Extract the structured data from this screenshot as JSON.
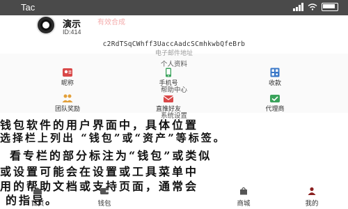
{
  "status_bar": {
    "time": "Tac"
  },
  "profile": {
    "name": "演示",
    "ghost_text": "有效合成",
    "id_label": "ID:414"
  },
  "wallet": {
    "address": "c2RdTSqCWhff3UaccAadcSCmhkwbQfeBrb",
    "address_ghost": "电子邮件地址"
  },
  "sections": {
    "user_info": "个人资料",
    "help_center": "帮助中心",
    "settings": "系统设置"
  },
  "menu": {
    "row1": [
      {
        "label": "昵称",
        "icon": "user-card-icon"
      },
      {
        "label": "手机号",
        "icon": "phone-icon"
      },
      {
        "label": "收款",
        "icon": "qr-icon"
      }
    ],
    "row2": [
      {
        "label": "团队奖励",
        "icon": "team-icon"
      },
      {
        "label": "直推好友",
        "icon": "invite-icon"
      },
      {
        "label": "代理商",
        "icon": "agent-icon"
      }
    ]
  },
  "overlay": {
    "line1": "钱包软件的用户界面中，具体位置",
    "line2": "选择栏上列出 “钱包”或“资产”等标签。",
    "line3": "看专栏的部分标注为“钱包”或类似",
    "line4": "或设置可能会在设置或工具菜单中",
    "line5": "用的帮助文档或支持页面，通常会",
    "line6": "的指导。"
  },
  "tabbar": {
    "tabs": [
      {
        "label": "首页",
        "icon": "home-icon"
      },
      {
        "label": "钱包",
        "icon": "wallet-icon"
      },
      {
        "label": "商城",
        "icon": "shop-icon"
      },
      {
        "label": "我的",
        "icon": "profile-icon"
      }
    ]
  },
  "colors": {
    "status_bar": "#4a4a4a",
    "accent_red": "#d94848",
    "accent_green": "#3aa35b",
    "accent_blue": "#3a78c8",
    "accent_orange": "#e3a03a"
  }
}
